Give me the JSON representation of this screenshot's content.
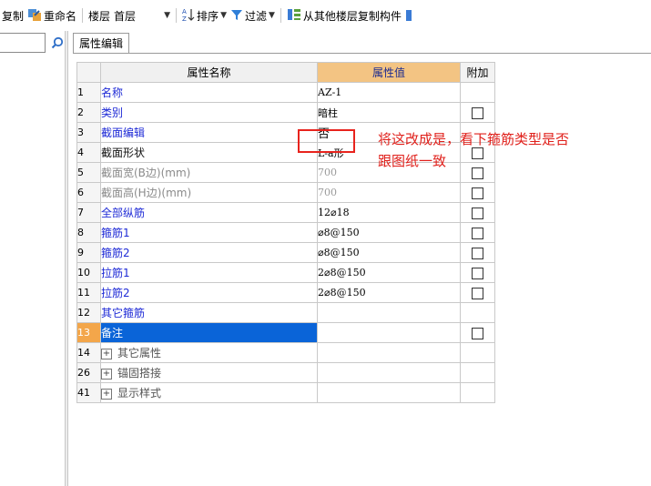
{
  "toolbar": {
    "copy_label": "复制",
    "rename_label": "重命名",
    "floor_label": "楼层",
    "floor_value": "首层",
    "sort_label": "排序",
    "filter_label": "过滤",
    "copy_from_floor_label": "从其他楼层复制构件"
  },
  "tab": {
    "label": "属性编辑"
  },
  "grid": {
    "headers": {
      "name": "属性名称",
      "value": "属性值",
      "add": "附加"
    },
    "rows": [
      {
        "num": "1",
        "name": "名称",
        "value": "AZ-1"
      },
      {
        "num": "2",
        "name": "类别",
        "value": "暗柱"
      },
      {
        "num": "3",
        "name": "截面编辑",
        "value": "否"
      },
      {
        "num": "4",
        "name": "截面形状",
        "value": "L-a形"
      },
      {
        "num": "5",
        "name": "截面宽(B边)(mm)",
        "value": "700"
      },
      {
        "num": "6",
        "name": "截面高(H边)(mm)",
        "value": "700"
      },
      {
        "num": "7",
        "name": "全部纵筋",
        "value": "12⌀18"
      },
      {
        "num": "8",
        "name": "箍筋1",
        "value": "⌀8@150"
      },
      {
        "num": "9",
        "name": "箍筋2",
        "value": "⌀8@150"
      },
      {
        "num": "10",
        "name": "拉筋1",
        "value": "2⌀8@150"
      },
      {
        "num": "11",
        "name": "拉筋2",
        "value": "2⌀8@150"
      },
      {
        "num": "12",
        "name": "其它箍筋",
        "value": ""
      },
      {
        "num": "13",
        "name": "备注",
        "value": ""
      },
      {
        "num": "14",
        "name": "其它属性",
        "value": ""
      },
      {
        "num": "26",
        "name": "锚固搭接",
        "value": ""
      },
      {
        "num": "41",
        "name": "显示样式",
        "value": ""
      }
    ]
  },
  "annotation": {
    "line1": "将这改成是，看下箍筋类型是否",
    "line2": "跟图纸一致"
  },
  "colors": {
    "header_value_bg": "#f3c483",
    "selected_row": "#0a64d8",
    "annotation": "#e0201b",
    "property_blue": "#1e2ad6"
  }
}
